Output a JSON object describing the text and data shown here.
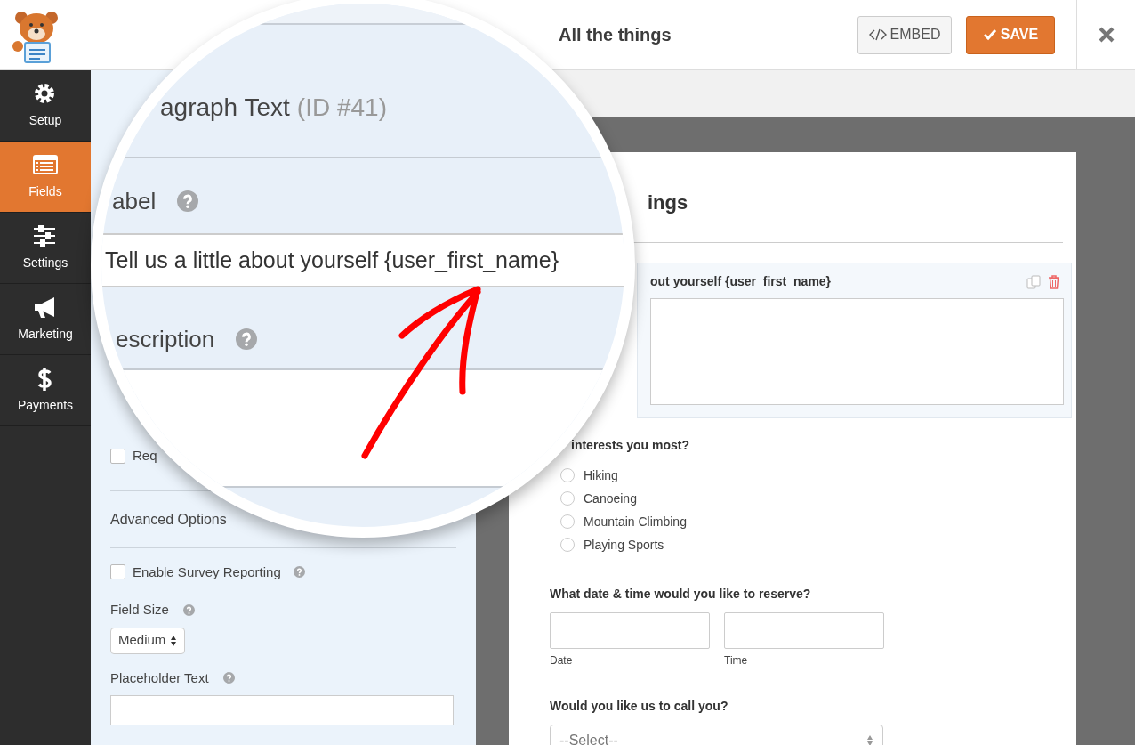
{
  "header": {
    "title": "All the things",
    "buttons": [
      {
        "label": "EMBED",
        "kind": "embed"
      },
      {
        "label": "SAVE",
        "kind": "save"
      }
    ]
  },
  "sidebar": {
    "items": [
      {
        "label": "Setup",
        "kind": "gear",
        "selected": false
      },
      {
        "label": "Fields",
        "kind": "list",
        "selected": true
      },
      {
        "label": "Settings",
        "kind": "sliders",
        "selected": false
      },
      {
        "label": "Marketing",
        "kind": "megaphone",
        "selected": false
      },
      {
        "label": "Payments",
        "kind": "dollar",
        "selected": false
      }
    ]
  },
  "field_options": {
    "required": {
      "label": "Req",
      "checked": false
    },
    "advanced_title": "Advanced Options",
    "survey": {
      "label": "Enable Survey Reporting",
      "checked": false
    },
    "field_size": {
      "label": "Field Size",
      "value": "Medium"
    },
    "placeholder_text": {
      "label": "Placeholder Text"
    }
  },
  "preview": {
    "title": "ings",
    "fields": [
      {
        "kind": "textarea",
        "label": "out yourself {user_first_name}",
        "selected": true
      },
      {
        "kind": "radio",
        "label": "interests you most?",
        "options": [
          {
            "label": "Hiking",
            "selected": false
          },
          {
            "label": "Canoeing",
            "selected": false
          },
          {
            "label": "Mountain Climbing",
            "selected": false
          },
          {
            "label": "Playing Sports",
            "selected": false
          }
        ]
      },
      {
        "kind": "datetime",
        "label": "What date & time would you like to reserve?",
        "sublabels": [
          "Date",
          "Time"
        ]
      },
      {
        "kind": "select",
        "label": "Would you like us to call you?",
        "value": "--Select--"
      }
    ]
  },
  "magnifier": {
    "field_title": "agraph Text",
    "field_id": "(ID #41)",
    "label_heading": "abel",
    "label_value": "Tell us a little about yourself {user_first_name}",
    "description_heading": "escription"
  }
}
